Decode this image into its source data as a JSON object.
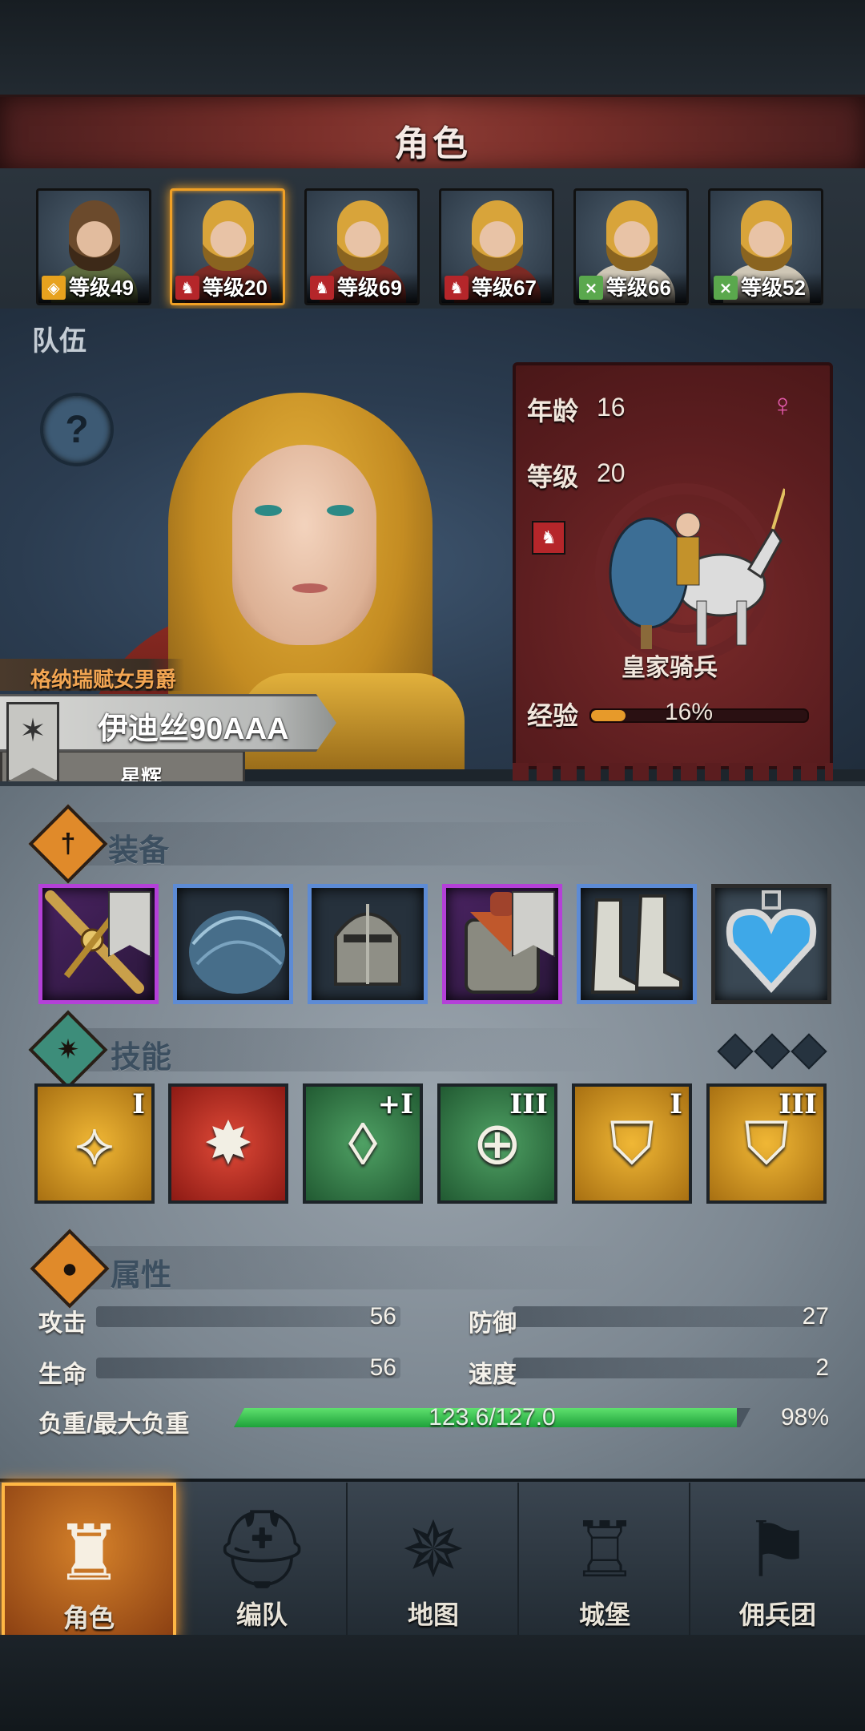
{
  "header": {
    "title": "角色"
  },
  "roster": [
    {
      "class_icon": "shield-icon",
      "level": "等级49"
    },
    {
      "class_icon": "horse-icon",
      "level": "等级20"
    },
    {
      "class_icon": "horse-icon",
      "level": "等级69"
    },
    {
      "class_icon": "horse-icon",
      "level": "等级67"
    },
    {
      "class_icon": "bow-icon",
      "level": "等级66"
    },
    {
      "class_icon": "bow-icon",
      "level": "等级52"
    }
  ],
  "team_label": "队伍",
  "hero": {
    "title": "格纳瑞赋女男爵",
    "name": "伊迪丝90AAA",
    "subtitle": "星辉"
  },
  "info": {
    "age_label": "年龄",
    "age": "16",
    "level_label": "等级",
    "level": "20",
    "unit_name": "皇家骑兵",
    "exp_label": "经验",
    "exp_pct": "16%",
    "exp_fraction": 0.16
  },
  "equipment": {
    "title": "装备",
    "slots": [
      "sword-icon",
      "plume-icon",
      "helmet-icon",
      "armor-icon",
      "boots-icon",
      "heart-amulet-icon"
    ]
  },
  "skills": {
    "title": "技能",
    "items": [
      {
        "rank": "I",
        "icon": "charge-icon"
      },
      {
        "rank": "",
        "icon": "burst-icon"
      },
      {
        "rank": "+I",
        "icon": "crystal-icon"
      },
      {
        "rank": "III",
        "icon": "target-icon"
      },
      {
        "rank": "I",
        "icon": "shield-break-icon"
      },
      {
        "rank": "III",
        "icon": "shield-break-icon"
      }
    ]
  },
  "attributes": {
    "title": "属性",
    "attack_label": "攻击",
    "attack": "56",
    "defense_label": "防御",
    "defense": "27",
    "hp_label": "生命",
    "hp": "56",
    "speed_label": "速度",
    "speed": "2",
    "load_label": "负重/最大负重",
    "load_text": "123.6/127.0",
    "load_pct": "98%",
    "load_fraction": 0.973
  },
  "nav": [
    {
      "label": "角色",
      "active": true
    },
    {
      "label": "编队",
      "active": false
    },
    {
      "label": "地图",
      "active": false
    },
    {
      "label": "城堡",
      "active": false
    },
    {
      "label": "佣兵团",
      "active": false
    }
  ],
  "colors": {
    "accent_orange": "#f0a025",
    "exp_bar": "#e79a2a",
    "load_bar": "#3cc152",
    "epic_border": "#b440d8",
    "rare_border": "#5d8bd5"
  }
}
